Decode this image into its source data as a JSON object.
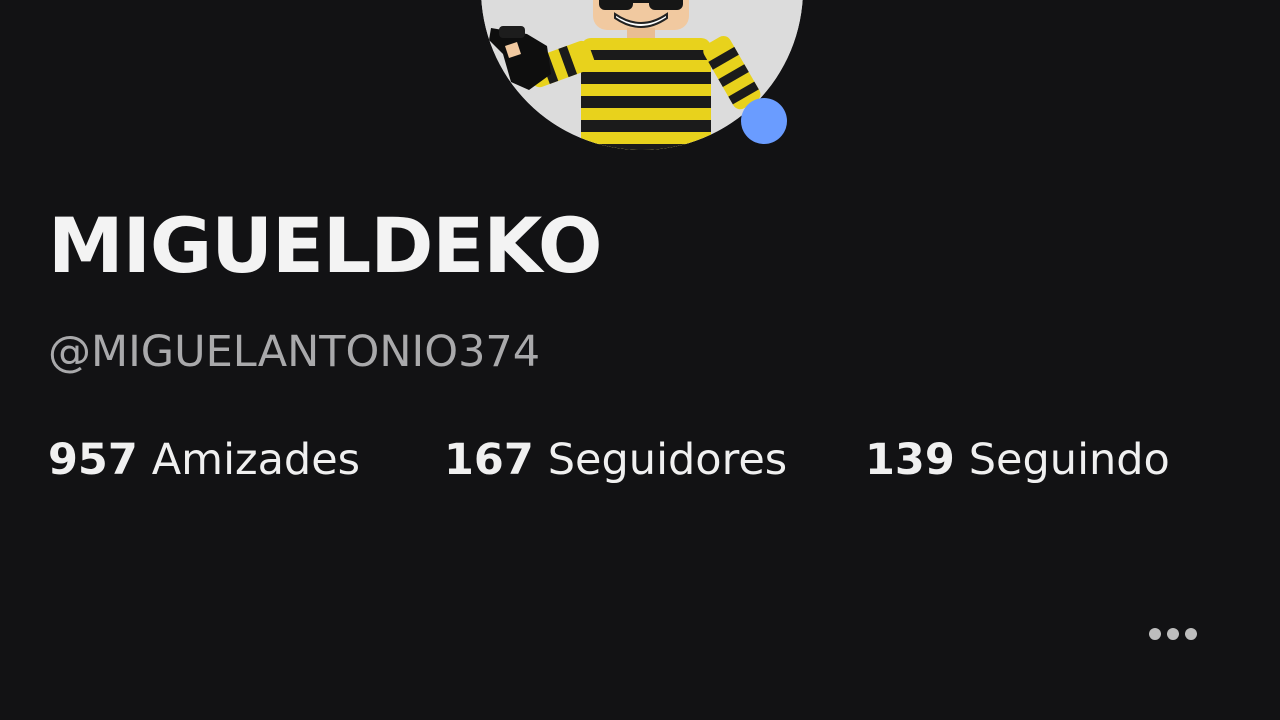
{
  "profile": {
    "display_name": "MIGUELDEKO",
    "username": "@MIGUELANTONIO374",
    "avatar_icon": "avatar-character",
    "presence_status_color": "#6a9cff"
  },
  "stats": {
    "friends": {
      "count": "957",
      "label": "Amizades"
    },
    "followers": {
      "count": "167",
      "label": "Seguidores"
    },
    "following": {
      "count": "139",
      "label": "Seguindo"
    }
  },
  "actions": {
    "more_icon": "more-horizontal-icon"
  },
  "colors": {
    "background": "#121214",
    "text_primary": "#f3f3f3",
    "text_secondary": "#a9a9ab",
    "avatar_bg": "#dcdcdc",
    "shirt_yellow": "#e8d21c",
    "shirt_black": "#1b1b1b"
  }
}
